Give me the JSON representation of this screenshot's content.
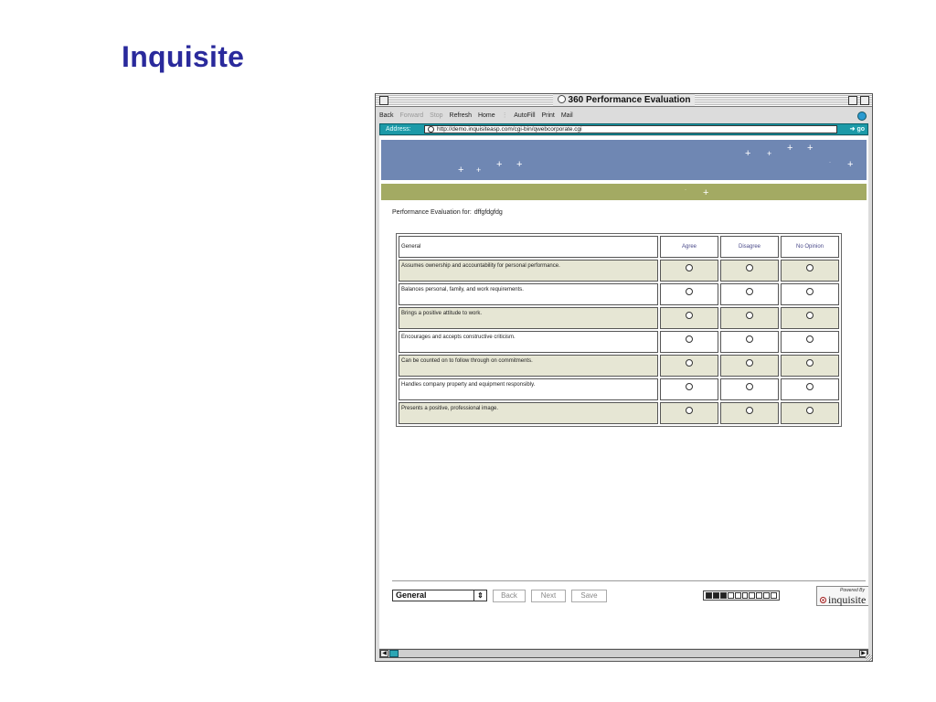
{
  "slide": {
    "title": "Inquisite"
  },
  "window": {
    "title": "360 Performance Evaluation",
    "toolbar": {
      "back": "Back",
      "forward": "Forward",
      "stop": "Stop",
      "refresh": "Refresh",
      "home": "Home",
      "autofill": "AutoFill",
      "print": "Print",
      "mail": "Mail"
    },
    "address": {
      "label": "Address:",
      "url": "http://demo.inquisiteasp.com/cgi-bin/qwebcorporate.cgi",
      "go": "go"
    }
  },
  "page": {
    "eval_label": "Performance Evaluation for:",
    "eval_name": "dffgfdgfdg",
    "table": {
      "section": "General",
      "options": [
        "Agree",
        "Disagree",
        "No Opinion"
      ],
      "questions": [
        "Assumes ownership and accountability for personal performance.",
        "Balances personal, family, and work requirements.",
        "Brings a positive attitude to work.",
        "Encourages and accepts constructive criticism.",
        "Can be counted on to follow through on commitments.",
        "Handles company property and equipment responsibly.",
        "Presents a positive, professional image."
      ]
    },
    "nav": {
      "section_select": "General",
      "back": "Back",
      "next": "Next",
      "save": "Save",
      "progress_filled": 3,
      "progress_total": 10
    },
    "powered": {
      "by": "Powered By",
      "brand": "inquisite"
    }
  }
}
